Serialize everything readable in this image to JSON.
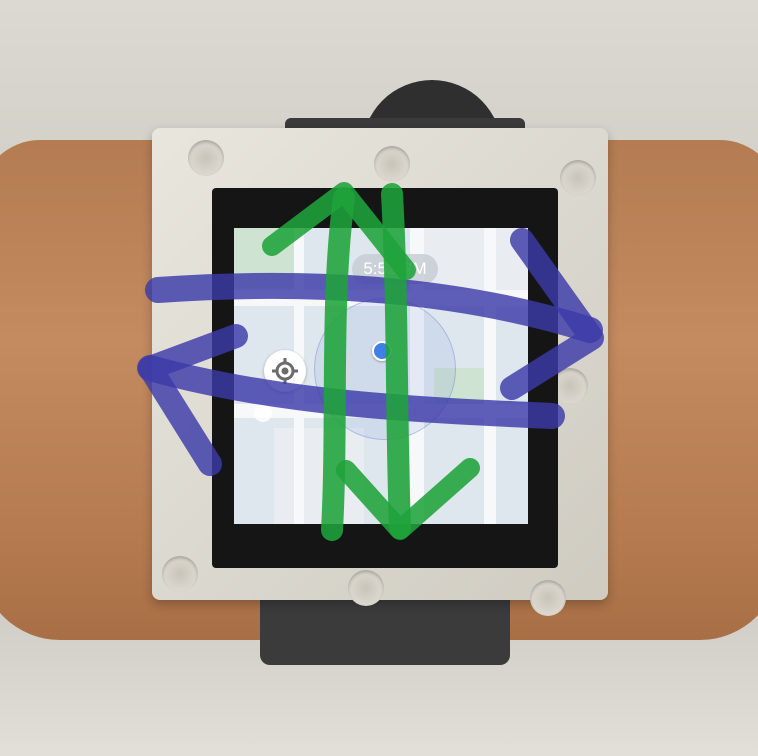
{
  "watch": {
    "status_time": "5:52 PM"
  },
  "map": {
    "locate_icon": "crosshair-icon",
    "location_marker": "blue-dot"
  },
  "annotations": {
    "horizontal_arrows_color": "#3c3aa8",
    "vertical_arrows_color": "#1fa33a"
  }
}
